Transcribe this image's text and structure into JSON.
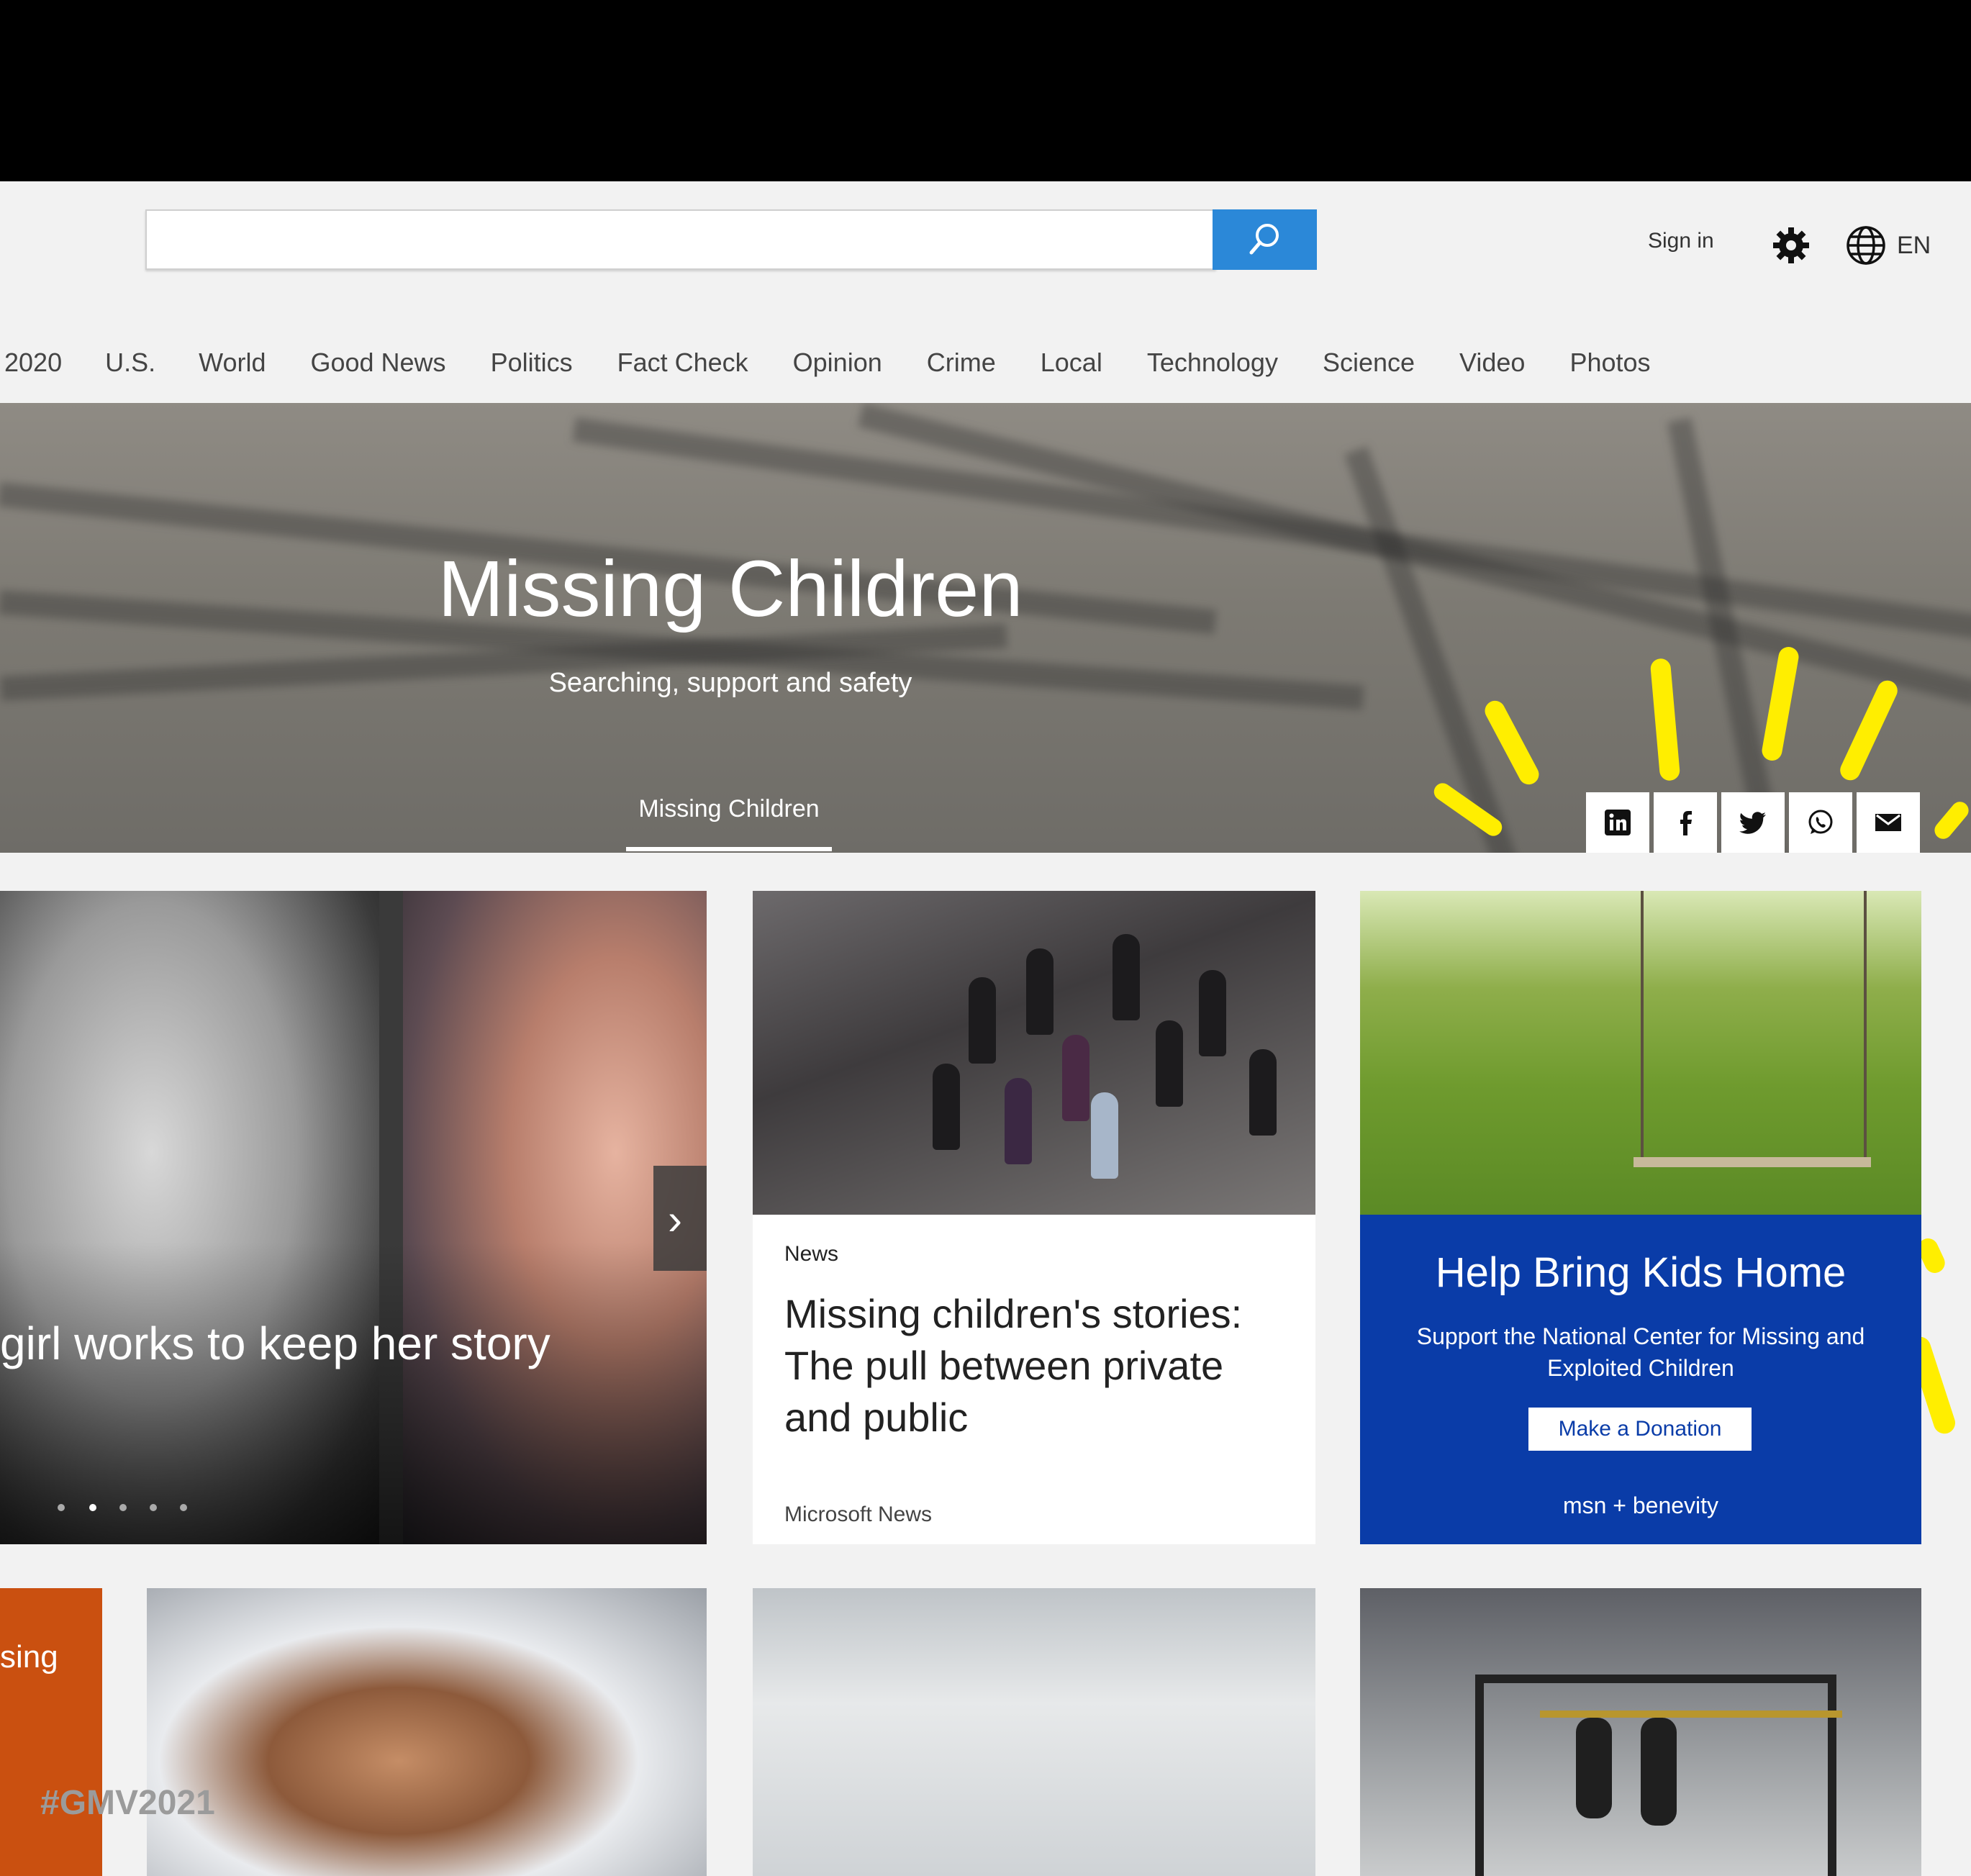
{
  "header": {
    "search_placeholder": "",
    "sign_in": "Sign in",
    "language": "EN"
  },
  "nav": {
    "items": [
      "2020",
      "U.S.",
      "World",
      "Good News",
      "Politics",
      "Fact Check",
      "Opinion",
      "Crime",
      "Local",
      "Technology",
      "Science",
      "Video",
      "Photos"
    ]
  },
  "hero": {
    "title": "Missing Children",
    "subtitle": "Searching, support and safety",
    "tab": "Missing Children",
    "share_icons": [
      "linkedin-icon",
      "facebook-icon",
      "twitter-icon",
      "whatsapp-icon",
      "email-icon"
    ]
  },
  "carousel": {
    "headline": "girl works to keep her story",
    "slide_count": 5,
    "active_slide": 2
  },
  "news_card": {
    "category": "News",
    "title": "Missing children's stories: The pull between private and public",
    "source": "Microsoft News"
  },
  "donate_card": {
    "title": "Help Bring Kids Home",
    "text": "Support the National Center for Missing and Exploited Children",
    "button": "Make a Donation",
    "brand": "msn + benevity"
  },
  "orange_tile": {
    "text": "sing"
  },
  "hashtag": "#GMV2021",
  "colors": {
    "accent": "#2b88d8",
    "donate_bg": "#0a3ca8",
    "orange_tile": "#ca5010",
    "marker": "#ffee00"
  }
}
